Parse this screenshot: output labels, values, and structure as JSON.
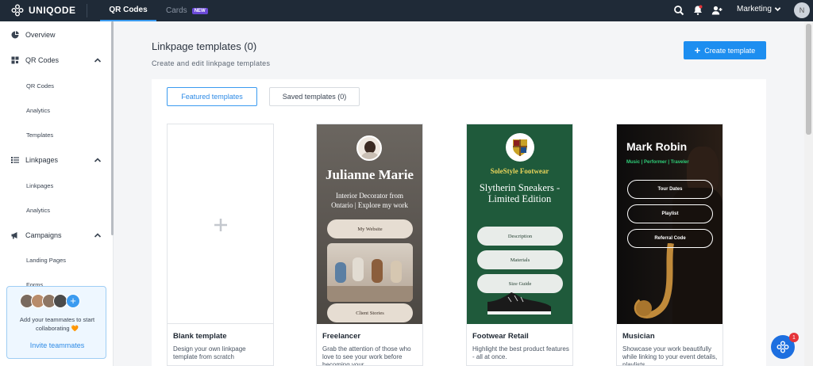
{
  "topbar": {
    "brand": "UNIQODE",
    "tabs": [
      {
        "label": "QR Codes",
        "active": true
      },
      {
        "label": "Cards",
        "badge": "NEW"
      }
    ],
    "workspace": "Marketing",
    "avatar_initial": "N",
    "notification_icon": "bell-icon"
  },
  "sidebar": {
    "overview": "Overview",
    "qr_codes": {
      "label": "QR Codes",
      "items": [
        "QR Codes",
        "Analytics",
        "Templates"
      ]
    },
    "linkpages": {
      "label": "Linkpages",
      "items": [
        "Linkpages",
        "Analytics"
      ]
    },
    "campaigns": {
      "label": "Campaigns",
      "items": [
        "Landing Pages",
        "Forms"
      ]
    },
    "invite": {
      "text": "Add your teammates to start collaborating 🧡",
      "link": "Invite teammates"
    }
  },
  "main": {
    "title": "Linkpage templates (0)",
    "subtitle": "Create and edit linkpage templates",
    "create_button": "Create template",
    "tabs": [
      "Featured templates",
      "Saved templates (0)"
    ],
    "cards": [
      {
        "name": "Blank template",
        "desc": "Design your own linkpage template from scratch"
      },
      {
        "name": "Freelancer",
        "desc": "Grab the attention of those who love to see your work before becoming your",
        "preview": {
          "person": "Julianne Marie",
          "tagline": "Interior Decorator from Ontario | Explore my work",
          "buttons": [
            "My Website",
            "Client Stories"
          ]
        }
      },
      {
        "name": "Footwear Retail",
        "desc": "Highlight the best product features - all at once.",
        "preview": {
          "brand": "SoleStyle Footwear",
          "headline": "Slytherin Sneakers - Limited Edition",
          "buttons": [
            "Description",
            "Materials",
            "Size Guide"
          ]
        }
      },
      {
        "name": "Musician",
        "desc": "Showcase your work beautifully while linking to your event details, playlists,",
        "preview": {
          "person": "Mark Robin",
          "tags": "Music | Performer | Traveler",
          "buttons": [
            "Tour Dates",
            "Playlist",
            "Referral Code"
          ]
        }
      }
    ]
  },
  "chat": {
    "badge": "1"
  }
}
